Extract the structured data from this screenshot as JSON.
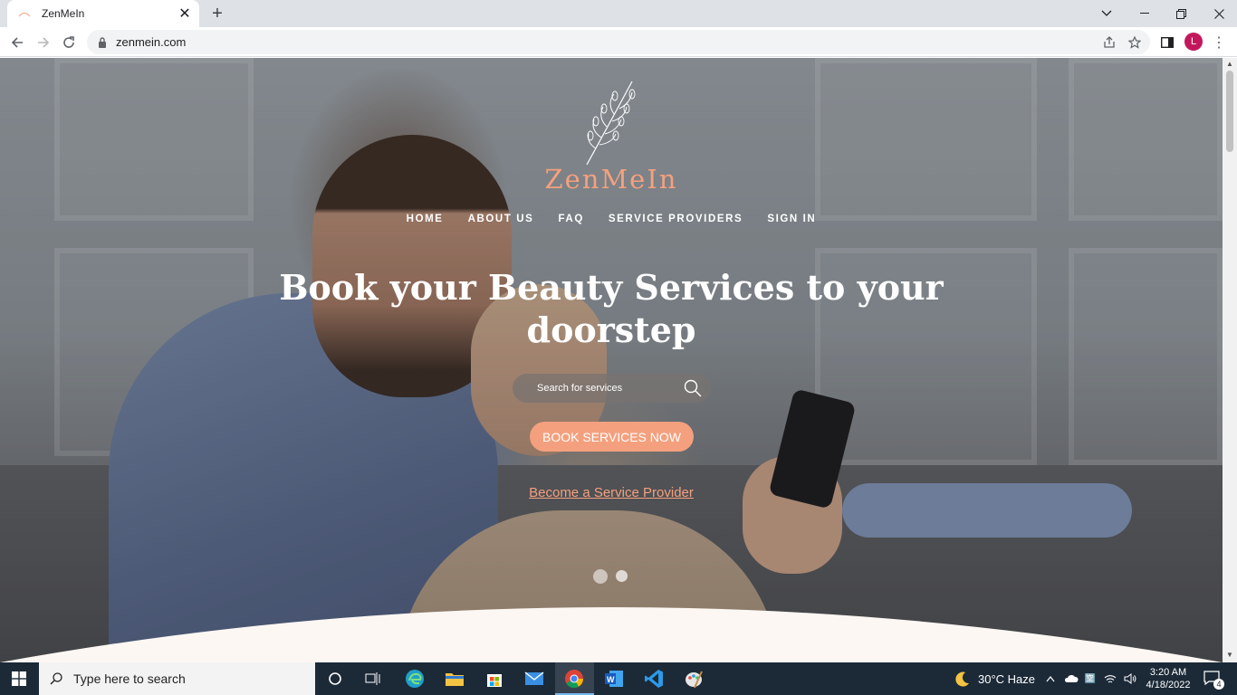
{
  "browser": {
    "tab_title": "ZenMeIn",
    "url": "zenmein.com",
    "profile_initial": "L"
  },
  "site": {
    "brand": "ZenMeIn",
    "nav": [
      "HOME",
      "ABOUT US",
      "FAQ",
      "SERVICE PROVIDERS",
      "SIGN IN"
    ],
    "headline_line1": "Book your Beauty Services to your",
    "headline_line2": "doorstep",
    "search_placeholder": "Search for services",
    "cta_label": "BOOK SERVICES NOW",
    "provider_link": "Become a Service Provider",
    "carousel_slides": 2,
    "accent_color": "#f4a07e"
  },
  "taskbar": {
    "search_placeholder": "Type here to search",
    "weather": "30°C  Haze",
    "time": "3:20 AM",
    "date": "4/18/2022",
    "notifications": "4"
  }
}
